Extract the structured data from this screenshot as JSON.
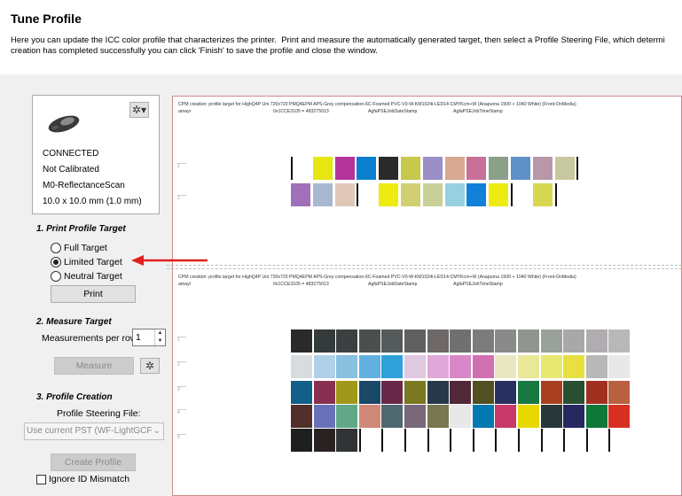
{
  "header": {
    "title": "Tune Profile",
    "description": "Here you can update the ICC color profile that characterizes the printer.  Print and measure the automatically generated target, then select a Profile Steering File, which determi\ncreation has completed successfully you can click 'Finish' to save the profile and close the window."
  },
  "device": {
    "status": "CONNECTED",
    "calibration": "Not Calibrated",
    "mode": "M0-ReflectanceScan",
    "aperture": "10.0 x 10.0 mm (1.0 mm)",
    "settings_icon": "gear-icon"
  },
  "print_section": {
    "heading": "1. Print Profile Target",
    "options": [
      "Full Target",
      "Limited Target",
      "Neutral Target"
    ],
    "selected": "Limited Target",
    "print_label": "Print"
  },
  "measure_section": {
    "heading": "2. Measure Target",
    "per_row_label": "Measurements per row",
    "per_row_value": "1",
    "measure_label": "Measure"
  },
  "profile_section": {
    "heading": "3. Profile Creation",
    "steering_label": "Profile Steering File:",
    "steering_value": "Use current PST (WF-LightGCF",
    "create_label": "Create Profile",
    "ignore_label": "Ignore ID Mismatch"
  },
  "preview": {
    "target1_caption": "CPM creation: profile target for HighQ4P Uni 720x720 PMQ4EPM APS-Grey compensation-6C-Foamed PVC-V0-W-KM1024i-LED14-CMYKcm+W (Anapurna 1500 + 1040 White) (Front-OnMedia)",
    "target1_line2a": "amayi",
    "target1_line2b": "0x1CCE3105 = 483275013",
    "target1_line2c": "AgfaPSEJobDateStamp",
    "target1_line2d": "AgfaPSEJobTimeStamp",
    "target2_caption": "CPM creation: profile target for HighQ4P Uni 720x720 PMQ4EPM APS-Grey compensation-6C-Foamed PVC-V0-W-KM1024i-LED14-CMYKcm+W (Anapurna 1500 + 1040 White) (Front-OnMedia)",
    "target2_line2a": "amayi",
    "target2_line2b": "0x1CCE3105 = 483275013",
    "target2_line2c": "AgfaPSEJobDateStamp",
    "target2_line2d": "AgfaPSEJobTimeStamp",
    "row_numbers": [
      "1",
      "2",
      "3",
      "4",
      "5"
    ]
  },
  "colors": {
    "annotation_arrow": "#e02020",
    "limited_row1": [
      "#ffffff",
      "#e8e612",
      "#b5349c",
      "#0a7fd0",
      "#2a2a2a",
      "#c8c84a",
      "#9a8fc8",
      "#d8a890",
      "#c87098",
      "#8aa088",
      "#6090c8",
      "#b898a8",
      "#c8c8a0"
    ],
    "limited_row2": [
      "#a070b8",
      "#a8b8d0",
      "#e0c8b8",
      "#ffffff",
      "#eeeb10",
      "#d0d070",
      "#c8d098",
      "#98d0e0",
      "#1080d8",
      "#eeeb10",
      "#ffffff",
      "#d8d850"
    ],
    "full_rows": [
      [
        "#2a2a2a",
        "#353a3a",
        "#3c4040",
        "#4a5050",
        "#555a5a",
        "#606060",
        "#6e6868",
        "#707070",
        "#7c7c7c",
        "#8a8a8a",
        "#909590",
        "#9aa09a",
        "#a8a8a8",
        "#b0acb0",
        "#b8b8b8"
      ],
      [
        "#d8dce0",
        "#b0d0e8",
        "#88c0e0",
        "#60b0e0",
        "#30a0d8",
        "#e0c8e0",
        "#e0a8d8",
        "#d888c8",
        "#d070b0",
        "#e8e8c0",
        "#e8e898",
        "#e8e870",
        "#e8e040",
        "#b8b8b8",
        "#e8e8e8"
      ],
      [
        "#106088",
        "#883050",
        "#a09818",
        "#1a4868",
        "#6a2848",
        "#7a7820",
        "#283848",
        "#502838",
        "#505020",
        "#283060",
        "#187840",
        "#a84020",
        "#285030",
        "#a03020",
        "#b86040"
      ],
      [
        "#503028",
        "#6870b8",
        "#60a888",
        "#d08878",
        "#506870",
        "#78687a",
        "#787850",
        "#e8e8e8",
        "#0078b0",
        "#c83868",
        "#e8d800",
        "#283838",
        "#282860",
        "#107838",
        "#d83020"
      ],
      [
        "#1e2020",
        "#2a2222",
        "#303434",
        "#ffffff",
        "#ffffff",
        "#ffffff",
        "#ffffff",
        "#ffffff",
        "#ffffff",
        "#ffffff",
        "#ffffff",
        "#ffffff",
        "#ffffff",
        "#ffffff",
        "#ffffff"
      ]
    ]
  }
}
